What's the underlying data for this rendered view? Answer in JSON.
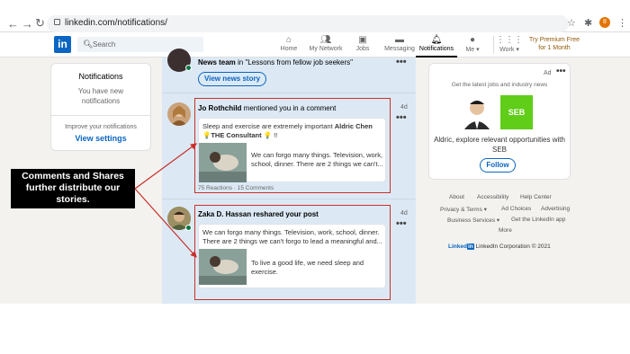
{
  "browser": {
    "url": "linkedin.com/notifications/",
    "profile_initial": "8"
  },
  "header": {
    "logo_text": "in",
    "search_placeholder": "Search",
    "nav": [
      {
        "label": "Home",
        "icon": "home-icon"
      },
      {
        "label": "My Network",
        "icon": "network-icon"
      },
      {
        "label": "Jobs",
        "icon": "briefcase-icon"
      },
      {
        "label": "Messaging",
        "icon": "chat-icon"
      },
      {
        "label": "Notifications",
        "icon": "bell-icon",
        "active": true
      },
      {
        "label": "Me",
        "icon": "avatar-icon"
      },
      {
        "label": "Work",
        "icon": "grid-icon"
      }
    ],
    "premium_line1": "Try Premium Free",
    "premium_line2": "for 1 Month"
  },
  "left_card": {
    "title": "Notifications",
    "subtitle": "You have new notifications",
    "improve": "Improve your notifications",
    "view_settings": "View settings"
  },
  "feed": {
    "top_item": {
      "text_bold": "News team",
      "text_rest": " in \"Lessons from fellow job seekers\"",
      "button": "View news story"
    },
    "item1": {
      "name": "Jo Rothchild",
      "action": " mentioned you in a comment",
      "ago": "4d",
      "comment_pre": "Sleep and exercise are extremely important ",
      "mention": "Aldric Chen",
      "emoji_mid": " 💡",
      "mention2": "THE Consultant",
      "emoji_end": " 💡 !!",
      "post_text": "We can forgo many things. Television, work, school, dinner. There are 2 things we can't...",
      "reactions": "75 Reactions",
      "dot": "·",
      "comments": "15 Comments"
    },
    "item2": {
      "name": "Zaka D. Hassan",
      "action": " reshared your post",
      "ago": "4d",
      "reshare_text": "We can forgo many things. Television, work, school, dinner. There are 2 things we can't forgo to lead a meaningful and...",
      "post_text": "To live a good life, we need sleep and exercise."
    }
  },
  "callout": {
    "text": "Comments and Shares further distribute our stories."
  },
  "ad": {
    "label": "Ad",
    "subtitle": "Get the latest jobs and industry news",
    "brand": "SEB",
    "text": "Aldric, explore relevant opportunities with SEB",
    "follow": "Follow"
  },
  "footer": {
    "about": "About",
    "accessibility": "Accessibility",
    "help": "Help Center",
    "privacy": "Privacy & Terms ▾",
    "ad_choices": "Ad Choices",
    "advertising": "Advertising",
    "business": "Business Services ▾",
    "app": "Get the LinkedIn app",
    "more": "More",
    "logo": "Linked",
    "logo_in": "in",
    "copyright": "LinkedIn Corporation © 2021"
  },
  "colors": {
    "linkedin_blue": "#0a66c2",
    "page_bg": "#f3f2ef",
    "feed_unread_bg": "#dce9f5",
    "highlight_box": "#c8302a",
    "seb_green": "#60cd18"
  }
}
